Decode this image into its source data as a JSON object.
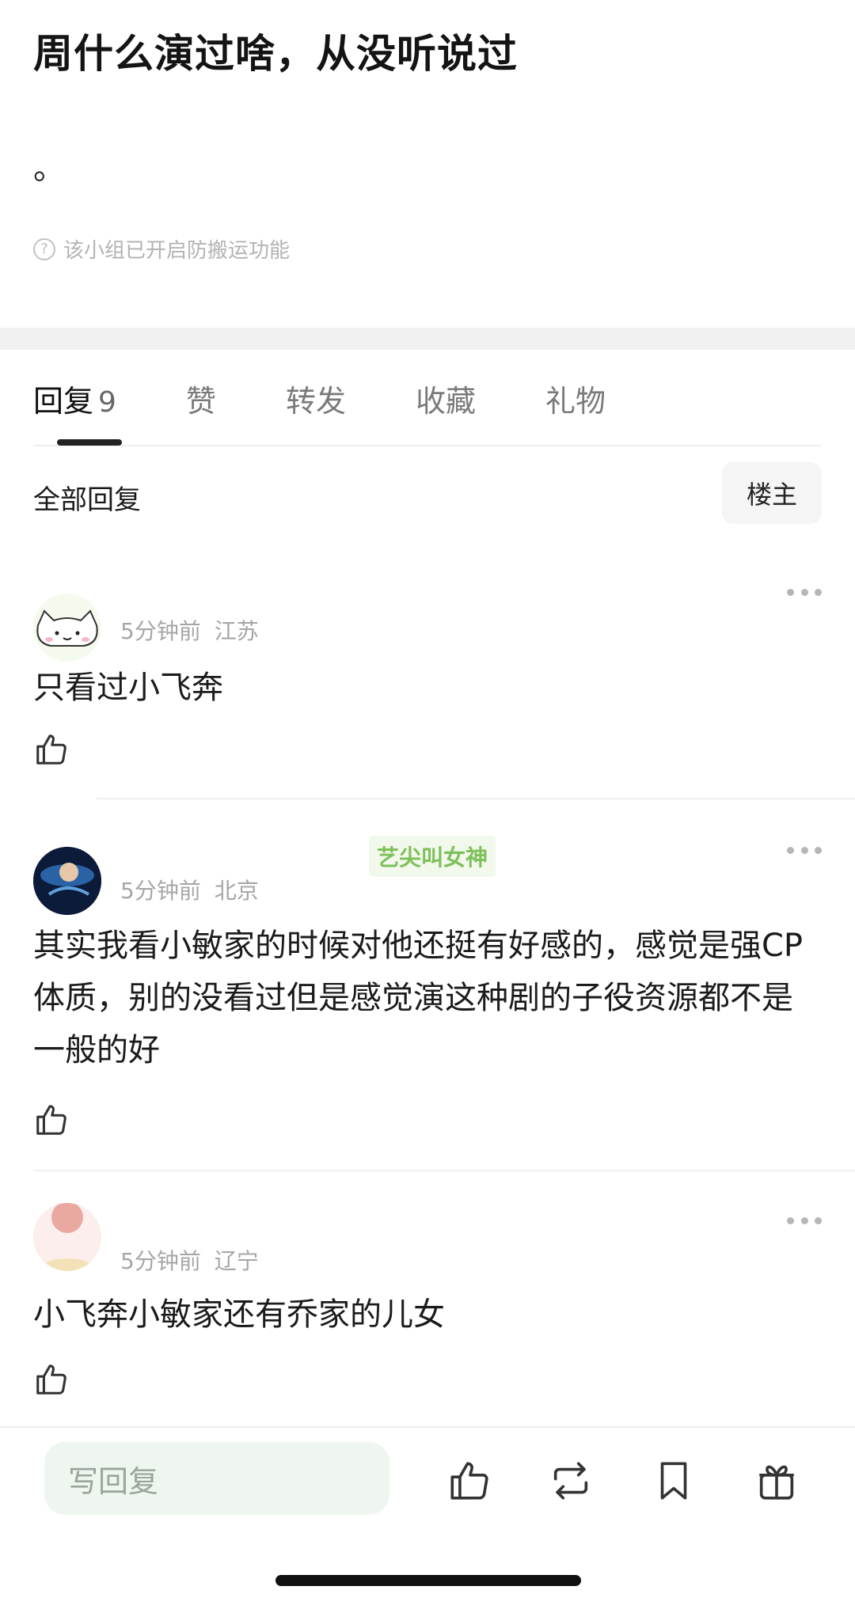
{
  "post": {
    "title": "周什么演过啥，从没听说过",
    "body": "。",
    "anti_repost_note": "该小组已开启防搬运功能",
    "help_icon": "?"
  },
  "tabs": {
    "reply_label": "回复",
    "reply_count": "9",
    "like_label": "赞",
    "forward_label": "转发",
    "favorite_label": "收藏",
    "gift_label": "礼物"
  },
  "filter": {
    "all_replies": "全部回复",
    "op_only": "楼主"
  },
  "comments": [
    {
      "time": "5分钟前",
      "location": "江苏",
      "text": "只看过小飞奔",
      "avatar": "cat-avatar"
    },
    {
      "time": "5分钟前",
      "location": "北京",
      "badge": "艺尖叫女神",
      "text": "其实我看小敏家的时候对他还挺有好感的，感觉是强CP体质，别的没看过但是感觉演这种剧的子役资源都不是一般的好",
      "avatar": "dark-blue-avatar"
    },
    {
      "time": "5分钟前",
      "location": "辽宁",
      "text": "小飞奔小敏家还有乔家的儿女",
      "avatar": "pink-avatar"
    }
  ],
  "bottom_bar": {
    "reply_placeholder": "写回复",
    "icons": [
      "thumb-up-icon",
      "repost-icon",
      "bookmark-icon",
      "gift-icon"
    ]
  },
  "colors": {
    "accent_green": "#7ec05a",
    "input_bg": "#eef6ef",
    "muted_text": "#a6a6a6"
  }
}
